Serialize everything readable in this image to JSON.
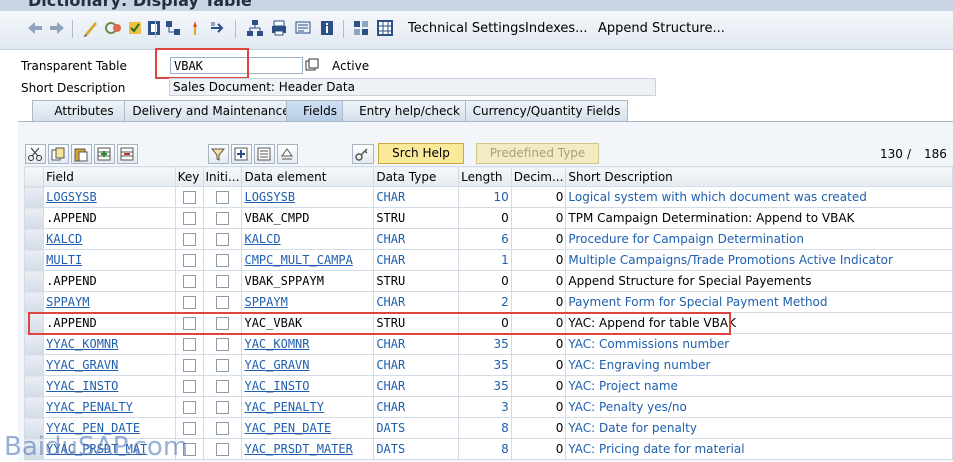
{
  "window": {
    "title": "Dictionary: Display Table"
  },
  "toolbar": {
    "technical_settings": "Technical Settings",
    "indexes": "Indexes...",
    "append_structure": "Append Structure..."
  },
  "header": {
    "table_type_label": "Transparent Table",
    "table_name": "VBAK",
    "status": "Active",
    "short_desc_label": "Short Description",
    "short_desc_value": "Sales Document: Header Data"
  },
  "tabs": [
    {
      "label": "Attributes"
    },
    {
      "label": "Delivery and Maintenance"
    },
    {
      "label": "Fields"
    },
    {
      "label": "Entry help/check"
    },
    {
      "label": "Currency/Quantity Fields"
    }
  ],
  "grid_toolbar": {
    "srch_help": "Srch Help",
    "predefined_type": "Predefined Type",
    "counter_current": "130",
    "counter_sep": "/",
    "counter_total": "186"
  },
  "columns": [
    "Field",
    "Key",
    "Initi...",
    "Data element",
    "Data Type",
    "Length",
    "Decim...",
    "Short Description"
  ],
  "rows": [
    {
      "field": "LOGSYSB",
      "data_element": "LOGSYSB",
      "data_type": "CHAR",
      "length": "10",
      "decimals": "0",
      "description": "Logical system with which document was created"
    },
    {
      "field": ".APPEND",
      "data_element": "VBAK_CMPD",
      "data_type": "STRU",
      "length": "0",
      "decimals": "0",
      "description": "TPM Campaign Determination: Append to VBAK"
    },
    {
      "field": "KALCD",
      "data_element": "KALCD",
      "data_type": "CHAR",
      "length": "6",
      "decimals": "0",
      "description": "Procedure for Campaign Determination"
    },
    {
      "field": "MULTI",
      "data_element": "CMPC_MULT_CAMPA",
      "data_type": "CHAR",
      "length": "1",
      "decimals": "0",
      "description": "Multiple Campaigns/Trade Promotions Active Indicator"
    },
    {
      "field": ".APPEND",
      "data_element": "VBAK_SPPAYM",
      "data_type": "STRU",
      "length": "0",
      "decimals": "0",
      "description": "Append Structure for Special Payements"
    },
    {
      "field": "SPPAYM",
      "data_element": "SPPAYM",
      "data_type": "CHAR",
      "length": "2",
      "decimals": "0",
      "description": "Payment Form for Special Payment Method"
    },
    {
      "field": ".APPEND",
      "data_element": "YAC_VBAK",
      "data_type": "STRU",
      "length": "0",
      "decimals": "0",
      "description": "YAC: Append for table VBAK"
    },
    {
      "field": "YYAC_KOMNR",
      "data_element": "YAC_KOMNR",
      "data_type": "CHAR",
      "length": "35",
      "decimals": "0",
      "description": "YAC: Commissions number"
    },
    {
      "field": "YYAC_GRAVN",
      "data_element": "YAC_GRAVN",
      "data_type": "CHAR",
      "length": "35",
      "decimals": "0",
      "description": "YAC: Engraving number"
    },
    {
      "field": "YYAC_INSTO",
      "data_element": "YAC_INSTO",
      "data_type": "CHAR",
      "length": "35",
      "decimals": "0",
      "description": "YAC: Project name"
    },
    {
      "field": "YYAC_PENALTY",
      "data_element": "YAC_PENALTY",
      "data_type": "CHAR",
      "length": "3",
      "decimals": "0",
      "description": "YAC: Penalty yes/no"
    },
    {
      "field": "YYAC_PEN_DATE",
      "data_element": "YAC_PEN_DATE",
      "data_type": "DATS",
      "length": "8",
      "decimals": "0",
      "description": "YAC: Date for penalty"
    },
    {
      "field": "YYAC_PRSDT_MAT",
      "data_element": "YAC_PRSDT_MATER",
      "data_type": "DATS",
      "length": "8",
      "decimals": "0",
      "description": "YAC: Pricing date for material"
    }
  ],
  "watermark": "BaiduSAP.com",
  "colors": {
    "highlight": "#e0443e",
    "link": "#1f5fae",
    "srch_help_bg": "#fbe99a"
  }
}
